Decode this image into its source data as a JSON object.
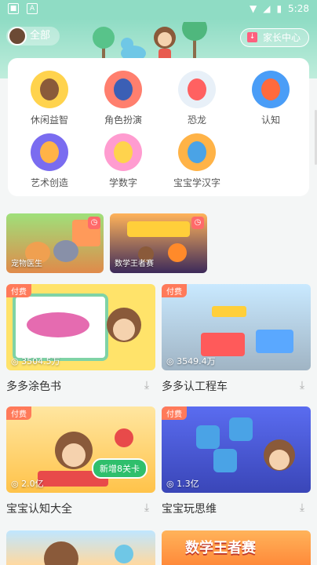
{
  "status_bar": {
    "time": "5:28",
    "left_icon_1": "■",
    "left_icon_2": "A"
  },
  "header": {
    "all_label": "全部",
    "parent_label": "家长中心"
  },
  "categories": [
    {
      "label": "休闲益智",
      "color": "#ffd34d"
    },
    {
      "label": "角色扮演",
      "color": "#ff7f6e"
    },
    {
      "label": "恐龙",
      "color": "#ff6161"
    },
    {
      "label": "认知",
      "color": "#4a9df7"
    },
    {
      "label": "艺术创造",
      "color": "#7a6cf0"
    },
    {
      "label": "学数字",
      "color": "#ff9cd0"
    },
    {
      "label": "宝宝学汉字",
      "color": "#ffb347"
    }
  ],
  "promos": [
    {
      "caption": "宠物医生"
    },
    {
      "caption": "数学王者赛"
    }
  ],
  "games": [
    {
      "title": "多多涂色书",
      "paid": "付费",
      "plays": "3504.5万"
    },
    {
      "title": "多多认工程车",
      "paid": "付费",
      "plays": "3549.4万"
    },
    {
      "title": "宝宝认知大全",
      "paid": "付费",
      "plays": "2.0亿",
      "badge": "新增8关卡"
    },
    {
      "title": "宝宝玩思维",
      "paid": "付费",
      "plays": "1.3亿"
    }
  ],
  "peek_title": "数学王者赛"
}
